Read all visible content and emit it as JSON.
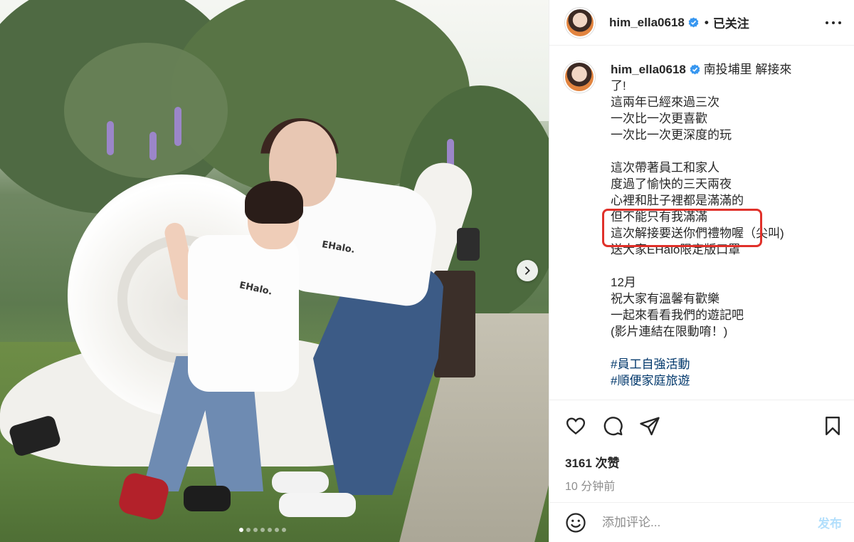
{
  "post": {
    "username": "him_ella0618",
    "follow_status": "已关注",
    "separator": "•",
    "verified_icon": "verified-badge-icon",
    "photo": {
      "shirt_logo": "EHalo.",
      "carousel_dots": 7,
      "active_dot": 0
    }
  },
  "caption": {
    "username": "him_ella0618",
    "first_line": "南投埔里 解接來",
    "lines": [
      "了!",
      "這兩年已經來過三次",
      "一次比一次更喜歡",
      "一次比一次更深度的玩",
      "",
      "這次帶著員工和家人",
      "度過了愉快的三天兩夜",
      "心裡和肚子裡都是滿滿的",
      "但不能只有我滿滿",
      "這次解接要送你們禮物喔（尖叫)",
      "送大家EHalo限定版口罩",
      "",
      "12月",
      "祝大家有溫馨有歡樂",
      "一起來看看我們的遊記吧",
      "(影片連結在限動唷！)",
      ""
    ],
    "hashtags": [
      "#員工自強活動",
      "#順便家庭旅遊"
    ]
  },
  "actions": {
    "like_icon": "heart-icon",
    "comment_icon": "comment-icon",
    "share_icon": "share-icon",
    "save_icon": "bookmark-icon",
    "likes": "3161 次赞",
    "time": "10 分钟前"
  },
  "comment_box": {
    "placeholder": "添加评论...",
    "post_label": "发布",
    "emoji_icon": "emoji-icon"
  },
  "colors": {
    "highlight": "#e0312a",
    "verified": "#3897f0",
    "hashtag": "#00376b",
    "post_disabled": "#b2dffc",
    "muted": "#8e8e8e"
  }
}
